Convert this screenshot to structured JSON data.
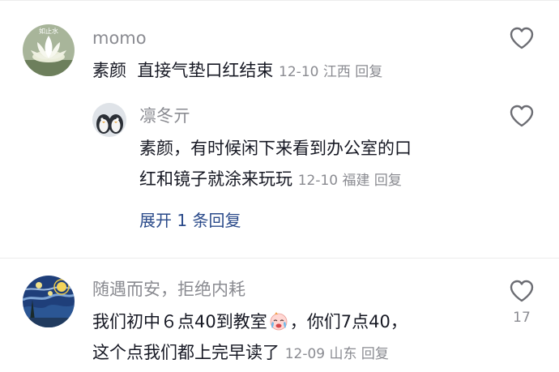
{
  "comments": [
    {
      "username": "momo",
      "avatar_icon": "lotus-flower-avatar",
      "text": "素颜  直接气垫口红结束",
      "date": "12-10",
      "location": "江西",
      "reply_label": "回复",
      "like_count": ""
    },
    {
      "username": "凛冬亓",
      "avatar_icon": "penguin-avatar",
      "text_line1": "素颜，有时候闲下来看到办公室的口",
      "text_line2": "红和镜子就涂来玩玩",
      "date": "12-10",
      "location": "福建",
      "reply_label": "回复",
      "like_count": "",
      "is_reply": true
    },
    {
      "username": "随遇而安，拒绝内耗",
      "avatar_icon": "starry-night-avatar",
      "text_part1": "我们初中６点40到教室",
      "emoji": "crying-face-emoji",
      "text_part2": "，你们7点40，",
      "text_line2": "这个点我们都上完早读了",
      "date": "12-09",
      "location": "山东",
      "reply_label": "回复",
      "like_count": "17"
    }
  ],
  "expand_replies": "展开 1 条回复",
  "colors": {
    "text": "#161823",
    "meta": "#8a8b91",
    "link": "#2a4a8a",
    "divider": "#ececec"
  }
}
